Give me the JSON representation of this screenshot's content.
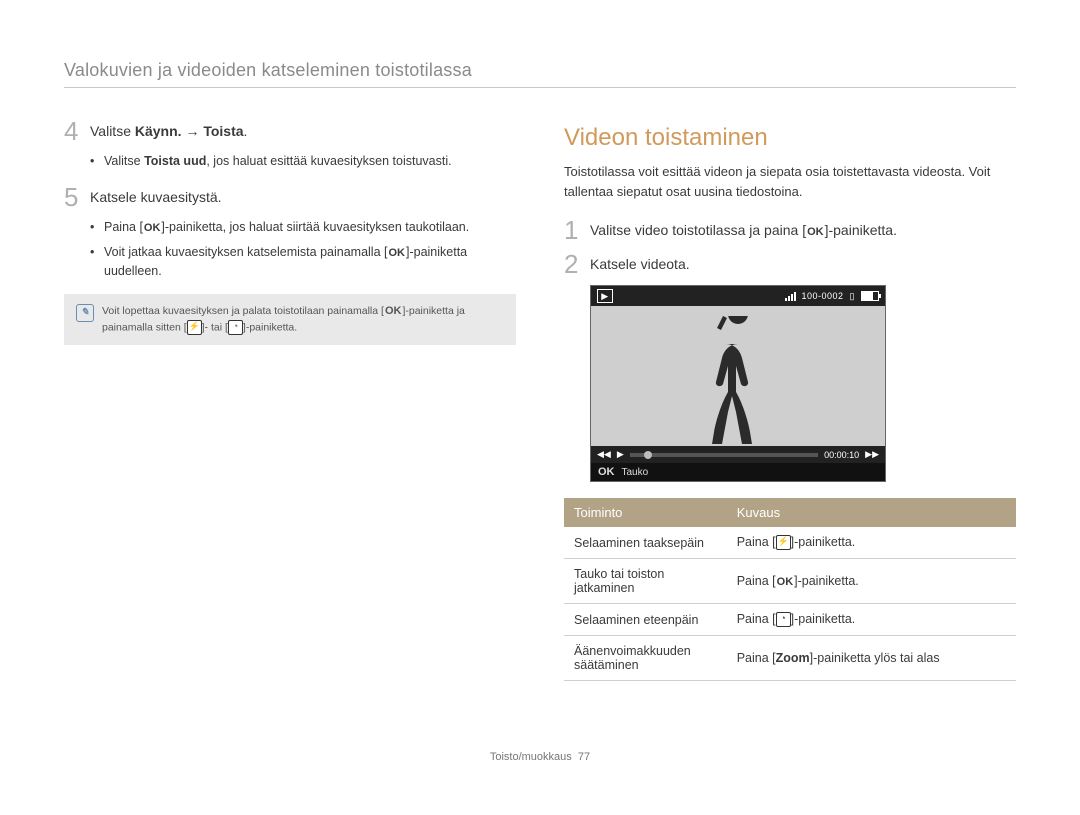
{
  "header": {
    "title": "Valokuvien ja videoiden katseleminen toistotilassa"
  },
  "left": {
    "steps": [
      {
        "num": "4",
        "text_pre": "Valitse ",
        "bold1": "Käynn.",
        "arrow": " → ",
        "bold2": "Toista",
        "text_post": ".",
        "subs": [
          {
            "pre": "Valitse ",
            "bold": "Toista uud",
            "post": ", jos haluat esittää kuvaesityksen toistuvasti."
          }
        ]
      },
      {
        "num": "5",
        "text_plain": "Katsele kuvaesitystä.",
        "subs": [
          {
            "pre": "Paina [",
            "icon": "OK",
            "post": "]-painiketta, jos haluat siirtää kuvaesityksen taukotilaan."
          },
          {
            "pre": "Voit jatkaa kuvaesityksen katselemista painamalla [",
            "icon": "OK",
            "post": "]-painiketta uudelleen."
          }
        ]
      }
    ],
    "note": {
      "pre": "Voit lopettaa kuvaesityksen ja palata toistotilaan painamalla [",
      "icon1": "OK",
      "mid": "]-painiketta ja painamalla sitten [",
      "icon2": "flash",
      "mid2": "]- tai [",
      "icon3": "timer",
      "post": "]-painiketta."
    }
  },
  "right": {
    "section_title": "Videon toistaminen",
    "intro": "Toistotilassa voit esittää videon ja siepata osia toistettavasta videosta. Voit tallentaa siepatut osat uusina tiedostoina.",
    "steps": [
      {
        "num": "1",
        "pre": "Valitse video toistotilassa ja paina [",
        "icon": "OK",
        "post": "]-painiketta."
      },
      {
        "num": "2",
        "text_plain": "Katsele videota."
      }
    ],
    "screen": {
      "counter": "100-0002",
      "time": "00:00:10",
      "pause_label": "Tauko",
      "ok": "OK"
    },
    "table": {
      "headers": {
        "func": "Toiminto",
        "desc": "Kuvaus"
      },
      "rows": [
        {
          "func": "Selaaminen taaksepäin",
          "pre": "Paina [",
          "icon": "flash",
          "post": "]-painiketta."
        },
        {
          "func": "Tauko tai toiston jatkaminen",
          "pre": "Paina [",
          "icon": "OK",
          "post": "]-painiketta."
        },
        {
          "func": "Selaaminen eteenpäin",
          "pre": "Paina [",
          "icon": "timer",
          "post": "]-painiketta."
        },
        {
          "func": "Äänenvoimakkuuden säätäminen",
          "pre": "Paina [",
          "bold": "Zoom",
          "post": "]-painiketta ylös tai alas"
        }
      ]
    }
  },
  "footer": {
    "section": "Toisto/muokkaus",
    "page": "77"
  }
}
